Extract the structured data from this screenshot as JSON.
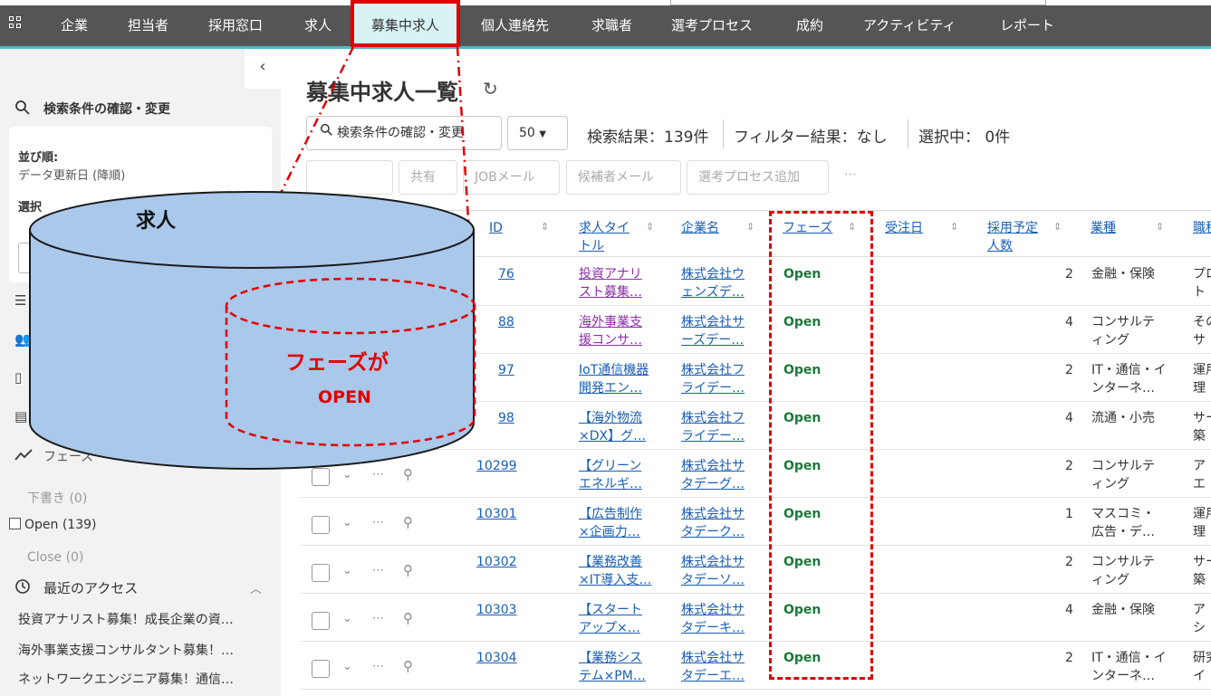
{
  "nav": {
    "items": [
      "企業",
      "担当者",
      "採用窓口",
      "求人",
      "募集中求人",
      "個人連絡先",
      "求職者",
      "選考プロセス",
      "成約",
      "アクティビティ",
      "レポート"
    ],
    "active": "募集中求人"
  },
  "sidebar": {
    "search_title": "検索条件の確認・変更",
    "sort_label": "並び順:",
    "sort_value": "データ更新日 (降順)",
    "select_label": "選択",
    "phase_label": "フェーズ",
    "phase_draft": "下書き (0)",
    "phase_open": "Open (139)",
    "phase_close": "Close (0)",
    "recent_title": "最近のアクセス",
    "recent_items": [
      "投資アナリスト募集！成長企業の資…",
      "海外事業支援コンサルタント募集！…",
      "ネットワークエンジニア募集！通信…"
    ]
  },
  "main": {
    "title": "募集中求人一覧",
    "search_button": "検索条件の確認・変更",
    "page_size": "50",
    "result_count": "検索結果：139件",
    "filter_result": "フィルター結果：なし",
    "selected": "選択中： 0件",
    "actions": [
      "共有",
      "JOBメール",
      "候補者メール",
      "選考プロセス追加"
    ],
    "more": "⋯"
  },
  "table": {
    "headers": [
      "ID",
      "求人タイトル",
      "企業名",
      "フェーズ",
      "受注日",
      "採用予定人数",
      "業種",
      "職種"
    ],
    "rows": [
      {
        "id": "76",
        "title": [
          "投資アナリ",
          "スト募集…"
        ],
        "company": [
          "株式会社ウ",
          "ェンズデ…"
        ],
        "phase": "Open",
        "count": "2",
        "industry": [
          "金融・保険",
          ""
        ],
        "job": [
          "プロ",
          "ト"
        ],
        "visited": true
      },
      {
        "id": "88",
        "title": [
          "海外事業支",
          "援コンサ…"
        ],
        "company": [
          "株式会社サ",
          "ーズデー…"
        ],
        "phase": "Open",
        "count": "4",
        "industry": [
          "コンサルテ",
          "ィング"
        ],
        "job": [
          "その",
          "サ"
        ],
        "visited": true
      },
      {
        "id": "97",
        "title": [
          "IoT通信機器",
          "開発エン…"
        ],
        "company": [
          "株式会社フ",
          "ライデー…"
        ],
        "phase": "Open",
        "count": "2",
        "industry": [
          "IT・通信・イ",
          "ンターネ…"
        ],
        "job": [
          "運用",
          "理"
        ],
        "visited": false
      },
      {
        "id": "98",
        "title": [
          "【海外物流",
          "×DX】グ…"
        ],
        "company": [
          "株式会社フ",
          "ライデー…"
        ],
        "phase": "Open",
        "count": "4",
        "industry": [
          "流通・小売",
          ""
        ],
        "job": [
          "サー",
          "築"
        ],
        "visited": false
      },
      {
        "id": "10299",
        "title": [
          "【グリーン",
          "エネルギ…"
        ],
        "company": [
          "株式会社サ",
          "タデーグ…"
        ],
        "phase": "Open",
        "count": "2",
        "industry": [
          "コンサルテ",
          "ィング"
        ],
        "job": [
          "ア",
          "エ"
        ],
        "visited": false
      },
      {
        "id": "10301",
        "title": [
          "【広告制作",
          "×企画力…"
        ],
        "company": [
          "株式会社サ",
          "タデーク…"
        ],
        "phase": "Open",
        "count": "1",
        "industry": [
          "マスコミ・",
          "広告・デ…"
        ],
        "job": [
          "運用",
          "理"
        ],
        "visited": false
      },
      {
        "id": "10302",
        "title": [
          "【業務改善",
          "×IT導入支…"
        ],
        "company": [
          "株式会社サ",
          "タデーソ…"
        ],
        "phase": "Open",
        "count": "2",
        "industry": [
          "コンサルテ",
          "ィング"
        ],
        "job": [
          "サー",
          "築"
        ],
        "visited": false
      },
      {
        "id": "10303",
        "title": [
          "【スタート",
          "アップ×…"
        ],
        "company": [
          "株式会社サ",
          "タデーキ…"
        ],
        "phase": "Open",
        "count": "4",
        "industry": [
          "金融・保険",
          ""
        ],
        "job": [
          "ア",
          "シ"
        ],
        "visited": false
      },
      {
        "id": "10304",
        "title": [
          "【業務シス",
          "テム×PM…"
        ],
        "company": [
          "株式会社サ",
          "タデーエ…"
        ],
        "phase": "Open",
        "count": "2",
        "industry": [
          "IT・通信・イ",
          "ンターネ…"
        ],
        "job": [
          "研究",
          "イ"
        ],
        "visited": false
      }
    ]
  },
  "annotation": {
    "db_label": "求人",
    "subset_line1": "フェーズが",
    "subset_line2": "OPEN",
    "cylinder_color": "#a9c8ea",
    "accent_red": "#e00000"
  }
}
